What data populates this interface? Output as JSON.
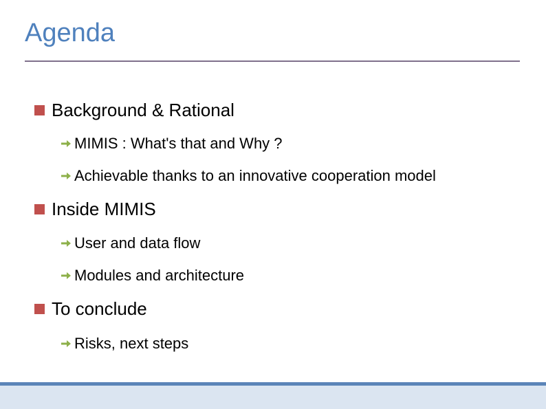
{
  "slide": {
    "title": "Agenda",
    "colors": {
      "title": "#4f81bd",
      "rule": "#7f6f8b",
      "level1_bullet": "#c0504d",
      "level2_arrow": "#8db04a",
      "footer_line": "#5b84b8",
      "footer_band": "#dbe5f1"
    },
    "sections": [
      {
        "label": "Background & Rational",
        "icon": "square-bullet-icon",
        "items": [
          {
            "label": "MIMIS : What's that and Why ?",
            "icon": "arrow-right-icon"
          },
          {
            "label": "Achievable thanks to an innovative cooperation model",
            "icon": "arrow-right-icon"
          }
        ]
      },
      {
        "label": "Inside MIMIS",
        "icon": "square-bullet-icon",
        "items": [
          {
            "label": "User and data flow",
            "icon": "arrow-right-icon"
          },
          {
            "label": "Modules and architecture",
            "icon": "arrow-right-icon"
          }
        ]
      },
      {
        "label": "To conclude",
        "icon": "square-bullet-icon",
        "items": [
          {
            "label": "Risks, next steps",
            "icon": "arrow-right-icon"
          }
        ]
      }
    ]
  }
}
